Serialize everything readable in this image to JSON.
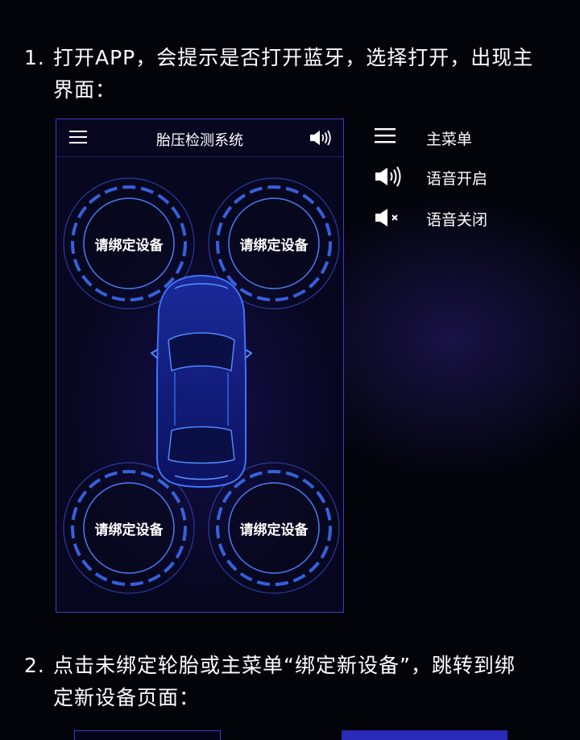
{
  "steps": [
    {
      "num": "1.",
      "line1": "打开APP，会提示是否打开蓝牙，选择打开，出现主",
      "line2": "界面："
    },
    {
      "num": "2.",
      "line1": "点击未绑定轮胎或主菜单“绑定新设备”，跳转到绑",
      "line2": "定新设备页面："
    }
  ],
  "phone": {
    "title": "胎压检测系统",
    "menu_icon": "menu-icon",
    "sound_icon": "speaker-on-icon",
    "wheels": [
      {
        "label": "请绑定设备"
      },
      {
        "label": "请绑定设备"
      },
      {
        "label": "请绑定设备"
      },
      {
        "label": "请绑定设备"
      }
    ],
    "accent": "#3a6cf0"
  },
  "legend": [
    {
      "icon": "menu-icon",
      "label": "主菜单"
    },
    {
      "icon": "speaker-on-icon",
      "label": "语音开启"
    },
    {
      "icon": "speaker-mute-icon",
      "label": "语音关闭"
    }
  ]
}
